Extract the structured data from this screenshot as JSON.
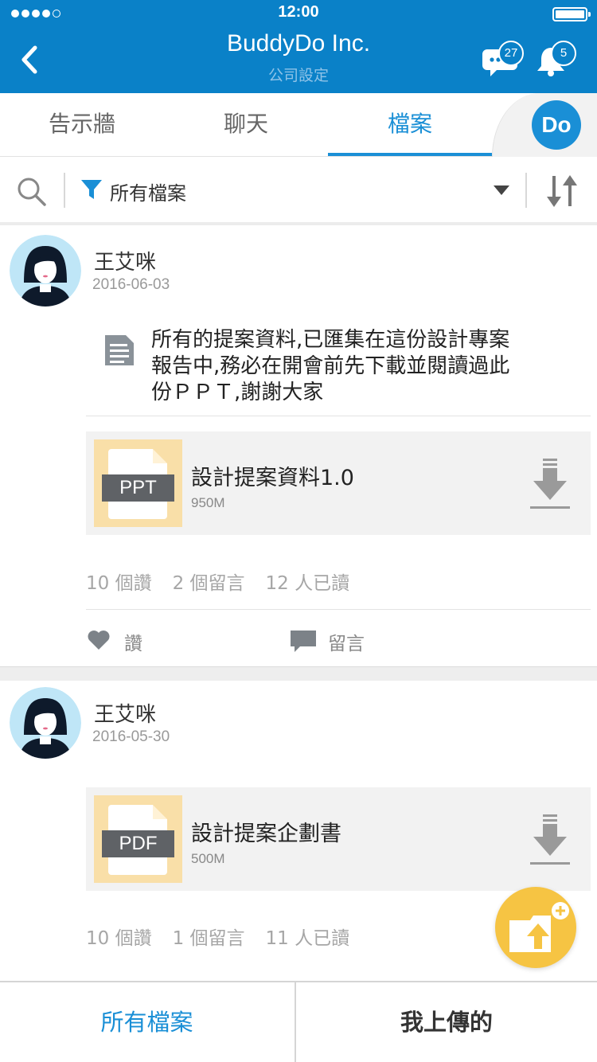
{
  "status_bar": {
    "time": "12:00"
  },
  "header": {
    "title": "BuddyDo Inc.",
    "subtitle": "公司設定",
    "chat_badge": "27",
    "notification_badge": "5"
  },
  "tabs": [
    {
      "label": "告示牆",
      "active": false
    },
    {
      "label": "聊天",
      "active": false
    },
    {
      "label": "檔案",
      "active": true
    }
  ],
  "brand_logo": "Do",
  "filter": {
    "label": "所有檔案"
  },
  "posts": [
    {
      "author": "王艾咪",
      "date": "2016-06-03",
      "text": "所有的提案資料,已匯集在這份設計專案報告中,務必在開會前先下載並閱讀過此份ＰＰＴ,謝謝大家",
      "file": {
        "type": "PPT",
        "name": "設計提案資料1.0",
        "size": "950M"
      },
      "stats": {
        "likes": "10 個讚",
        "comments": "2 個留言",
        "reads": "12 人已讀"
      },
      "actions": {
        "like": "讚",
        "comment": "留言"
      }
    },
    {
      "author": "王艾咪",
      "date": "2016-05-30",
      "file": {
        "type": "PDF",
        "name": "設計提案企劃書",
        "size": "500M"
      },
      "stats": {
        "likes": "10 個讚",
        "comments": "1 個留言",
        "reads": "11 人已讀"
      }
    }
  ],
  "bottom_tabs": [
    {
      "label": "所有檔案",
      "active": true
    },
    {
      "label": "我上傳的",
      "active": false
    }
  ],
  "colors": {
    "primary": "#0a81c8",
    "accent": "#1a8fd6",
    "fab": "#f6c443",
    "file_thumb": "#f9dfa8"
  },
  "icons": [
    "back-icon",
    "chat-icon",
    "bell-icon",
    "search-icon",
    "filter-icon",
    "sort-icon",
    "document-icon",
    "download-icon",
    "heart-icon",
    "comment-icon",
    "upload-icon"
  ]
}
